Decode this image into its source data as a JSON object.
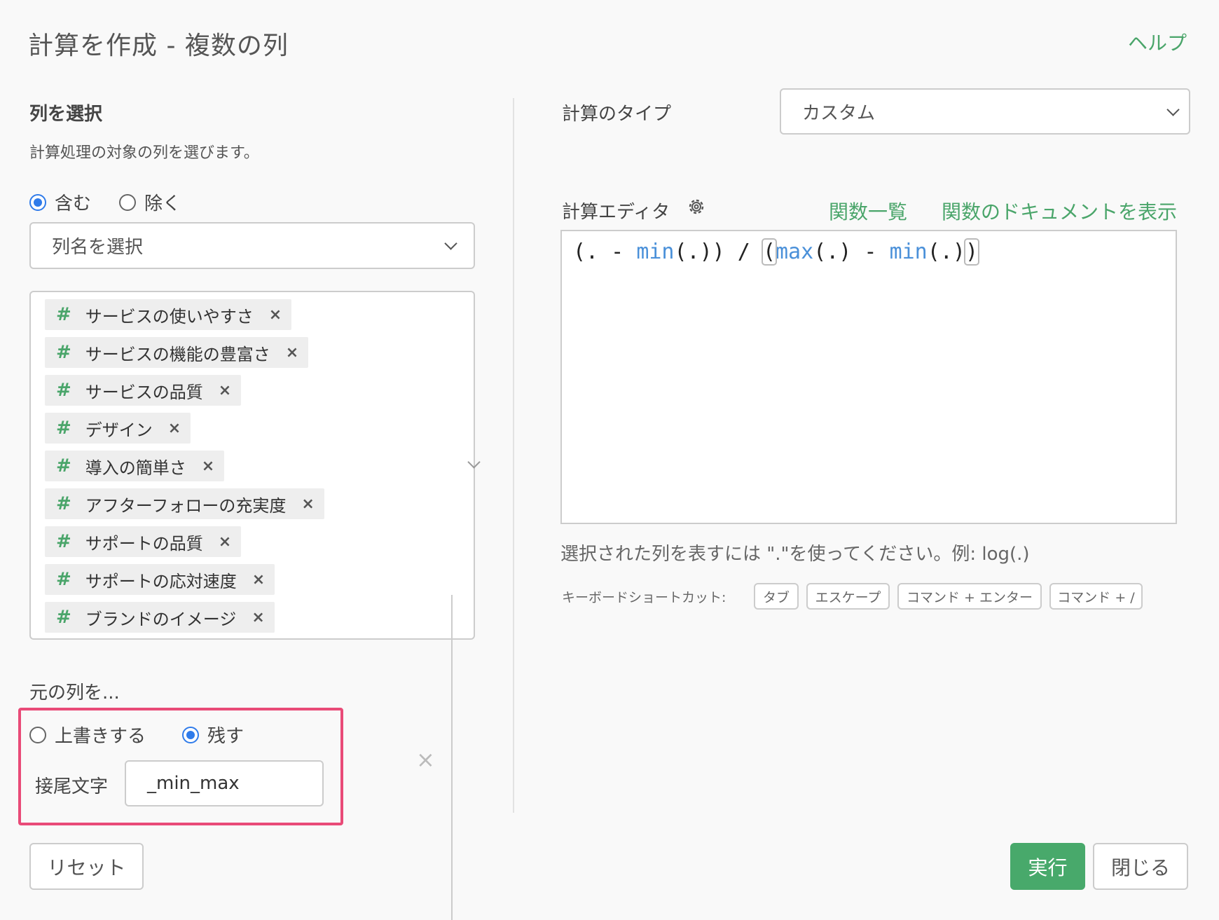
{
  "dialog": {
    "title": "計算を作成 - 複数の列",
    "help_label": "ヘルプ"
  },
  "columns": {
    "section_title": "列を選択",
    "description": "計算処理の対象の列を選びます。",
    "include_label": "含む",
    "exclude_label": "除く",
    "include_selected": true,
    "select_placeholder": "列名を選択",
    "tag_hash": "#",
    "tag_remove": "×",
    "clear_all": "×",
    "selected": [
      "サービスの使いやすさ",
      "サービスの機能の豊富さ",
      "サービスの品質",
      "デザイン",
      "導入の簡単さ",
      "アフターフォローの充実度",
      "サポートの品質",
      "サポートの応対速度",
      "ブランドのイメージ"
    ]
  },
  "original": {
    "label": "元の列を...",
    "overwrite_label": "上書きする",
    "keep_label": "残す",
    "keep_selected": true,
    "suffix_label": "接尾文字",
    "suffix_value": "_min_max"
  },
  "calc": {
    "type_label": "計算のタイプ",
    "type_value": "カスタム",
    "editor_label": "計算エディタ",
    "function_list_link": "関数一覧",
    "function_docs_link": "関数のドキュメントを表示",
    "code": {
      "t1": "(. - ",
      "f1": "min",
      "t2": "(.)) / ",
      "b1": "(",
      "f2": "max",
      "t3": "(.) - ",
      "f3": "min",
      "t4": "(.)",
      "b2": ")"
    },
    "hint": "選択された列を表すには \".\"を使ってください。例: log(.)",
    "shortcut_label": "キーボードショートカット:",
    "shortcuts": [
      "タブ",
      "エスケープ",
      "コマンド + エンター",
      "コマンド + /"
    ]
  },
  "buttons": {
    "reset": "リセット",
    "run": "実行",
    "close": "閉じる"
  },
  "colors": {
    "accent_green": "#4aa56a",
    "radio_blue": "#2f7bea",
    "highlight_pink": "#e94b78"
  }
}
